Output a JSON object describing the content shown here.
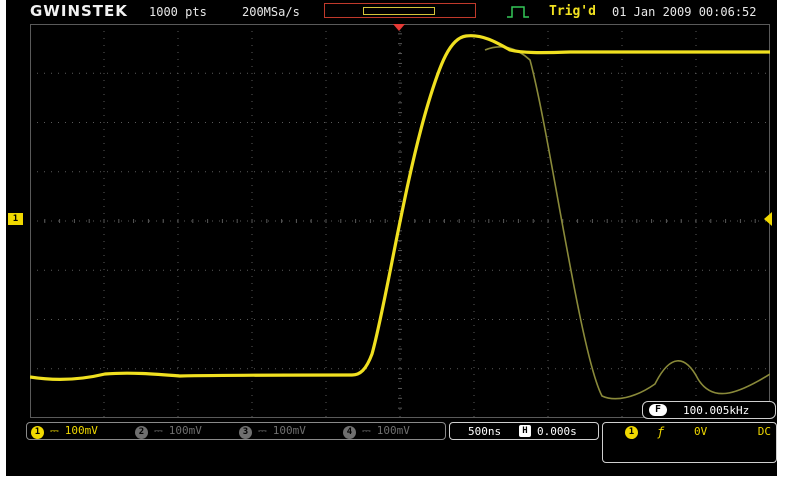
{
  "header": {
    "brand": "GWINSTEK",
    "record_length": "1000 pts",
    "sample_rate": "200MSa/s",
    "trigger_status": "Trig'd",
    "datetime": "01 Jan 2009 00:06:52"
  },
  "channel_marker": "1",
  "channels": [
    {
      "num": "1",
      "coupling": "⎓",
      "scale": "100mV"
    },
    {
      "num": "2",
      "coupling": "⎓",
      "scale": "100mV"
    },
    {
      "num": "3",
      "coupling": "⎓",
      "scale": "100mV"
    },
    {
      "num": "4",
      "coupling": "⎓",
      "scale": "100mV"
    }
  ],
  "timebase": {
    "scale": "500ns",
    "h_icon": "H",
    "position": "0.000s"
  },
  "frequency": {
    "icon": "F",
    "value": "100.005kHz"
  },
  "trigger": {
    "source": "1",
    "slope": "ƒ",
    "level": "0V",
    "coupling": "DC"
  },
  "colors": {
    "ch1": "#f0d800",
    "ref": "#8a8a3a",
    "grid": "#5a5a5a",
    "trigger_mark": "#e53935"
  },
  "icons": {
    "trigger_type": "pulse-trigger-icon",
    "trigger_position": "trigger-position-marker-icon",
    "channel_marker": "channel-1-ground-marker-icon",
    "trigger_level": "trigger-level-marker-icon"
  }
}
